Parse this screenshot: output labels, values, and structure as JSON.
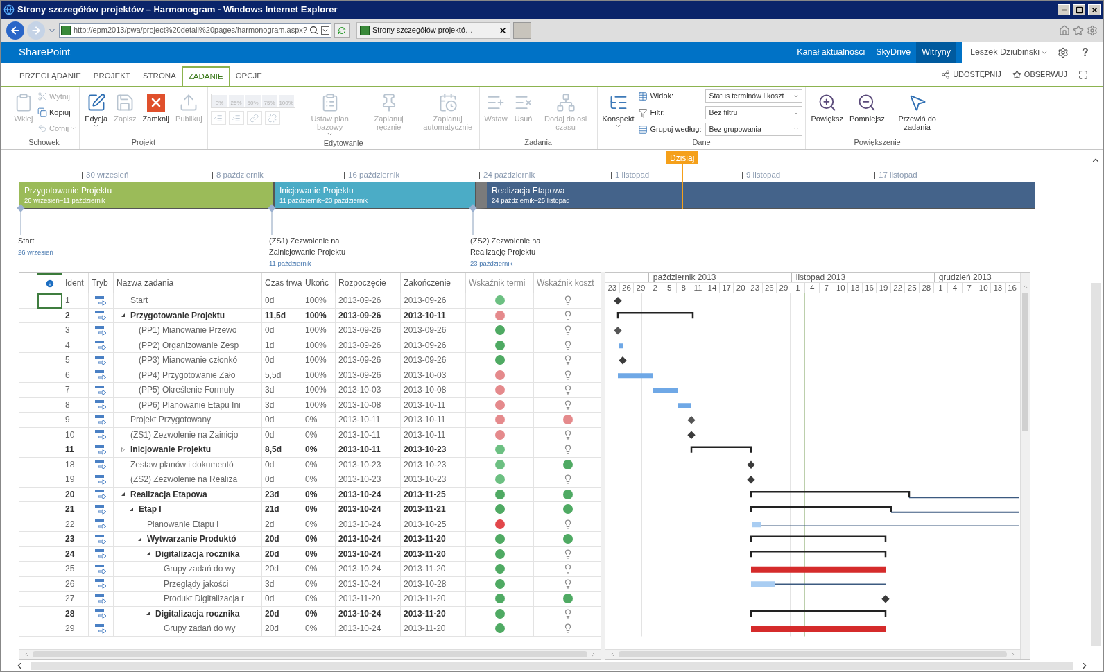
{
  "window": {
    "title": "Strony szczegółów projektów – Harmonogram - Windows Internet Explorer"
  },
  "browser": {
    "address": "http://epm2013/pwa/project%20detail%20pages/harmonogram.aspx?",
    "tab": "Strony szczegółów projektó…"
  },
  "suite_bar": {
    "brand": "SharePoint",
    "links": [
      {
        "label": "Kanał aktualności",
        "selected": false
      },
      {
        "label": "SkyDrive",
        "selected": false
      },
      {
        "label": "Witryny",
        "selected": true
      }
    ],
    "user": "Leszek Dziubiński",
    "help": "?"
  },
  "ribbon": {
    "tabs": [
      {
        "label": "PRZEGLĄDANIE",
        "selected": false
      },
      {
        "label": "PROJEKT",
        "selected": false
      },
      {
        "label": "STRONA",
        "selected": false
      },
      {
        "label": "ZADANIE",
        "selected": true
      },
      {
        "label": "OPCJE",
        "selected": false
      }
    ],
    "actions": [
      "UDOSTĘPNIJ",
      "OBSERWUJ"
    ],
    "groups": [
      {
        "title": "Schowek",
        "items": [
          {
            "kind": "large",
            "label": "Wklej",
            "disabled": true
          },
          {
            "kind": "small",
            "label": "Wytnij",
            "disabled": true
          },
          {
            "kind": "small",
            "label": "Kopiuj",
            "disabled": false
          },
          {
            "kind": "small",
            "label": "Cofnij",
            "disabled": true,
            "menu": true
          }
        ]
      },
      {
        "title": "Projekt",
        "items": [
          {
            "kind": "large",
            "label": "Edycja",
            "disabled": false,
            "menu": true
          },
          {
            "kind": "large",
            "label": "Zapisz",
            "disabled": true
          },
          {
            "kind": "large",
            "label": "Zamknij",
            "disabled": false
          },
          {
            "kind": "large",
            "label": "Publikuj",
            "disabled": true
          }
        ]
      },
      {
        "title": "Edytowanie",
        "items": [
          {
            "kind": "percent",
            "label": "0%",
            "disabled": true
          },
          {
            "kind": "percent",
            "label": "25%",
            "disabled": true
          },
          {
            "kind": "percent",
            "label": "50%",
            "disabled": true
          },
          {
            "kind": "percent",
            "label": "75%",
            "disabled": true
          },
          {
            "kind": "percent",
            "label": "100%",
            "disabled": true
          },
          {
            "kind": "tool",
            "disabled": true
          },
          {
            "kind": "tool",
            "disabled": true
          },
          {
            "kind": "tool",
            "disabled": true
          },
          {
            "kind": "tool",
            "disabled": true
          },
          {
            "kind": "large",
            "label": "Ustaw plan bazowy",
            "disabled": true,
            "menu": true
          },
          {
            "kind": "large",
            "label": "Zaplanuj ręcznie",
            "disabled": true
          },
          {
            "kind": "large",
            "label": "Zaplanuj automatycznie",
            "disabled": true
          }
        ]
      },
      {
        "title": "Zadania",
        "items": [
          {
            "kind": "large",
            "label": "Wstaw",
            "disabled": true
          },
          {
            "kind": "large",
            "label": "Usuń",
            "disabled": true
          },
          {
            "kind": "large",
            "label": "Dodaj do osi czasu",
            "disabled": true
          }
        ]
      },
      {
        "title": "Dane",
        "items": [
          {
            "kind": "large",
            "label": "Konspekt",
            "disabled": false,
            "menu": true
          },
          {
            "kind": "dropdown",
            "label": "Widok:",
            "value": "Status terminów i koszt",
            "disabled": false
          },
          {
            "kind": "dropdown",
            "label": "Filtr:",
            "value": "Bez filtru",
            "disabled": false
          },
          {
            "kind": "dropdown",
            "label": "Grupuj według:",
            "value": "Bez grupowania",
            "disabled": false
          }
        ]
      },
      {
        "title": "Powiększenie",
        "items": [
          {
            "kind": "large",
            "label": "Powiększ",
            "disabled": false
          },
          {
            "kind": "large",
            "label": "Pomniejsz",
            "disabled": false
          },
          {
            "kind": "large",
            "label": "Przewiń do zadania",
            "disabled": false
          }
        ]
      }
    ]
  },
  "timeline": {
    "today": "Dzisiaj",
    "ticks": [
      "30 wrzesień",
      "8 październik",
      "16 październik",
      "24 październik",
      "1 listopad",
      "9 listopad",
      "17 listopad"
    ],
    "phases": [
      {
        "title": "Przygotowanie Projektu",
        "dates": "26 wrzesień–11 październik",
        "color": "#9bbb59"
      },
      {
        "title": "Inicjowanie Projektu",
        "dates": "11 październik–23 październik",
        "color": "#4bacc6"
      },
      {
        "title": "Realizacja Etapowa",
        "dates": "24 październik–25 listopad",
        "color": "#44638a"
      }
    ],
    "milestones": [
      {
        "title": "Start",
        "date": "26 wrzesień"
      },
      {
        "title": "(ZS1) Zezwolenie na Zainicjowanie Projektu",
        "date": "11 październik"
      },
      {
        "title": "(ZS2) Zezwolenie na Realizację Projektu",
        "date": "23 październik"
      }
    ]
  },
  "grid": {
    "columns": [
      "Ident",
      "Tryb",
      "Nazwa zadania",
      "Czas trwa",
      "Ukońc",
      "Rozpoczęcie",
      "Zakończenie",
      "Wskaźnik termi",
      "Wskaźnik koszt"
    ],
    "rows": [
      {
        "id": "1",
        "name": "Start",
        "duration": "0d",
        "complete": "100%",
        "start": "2013-09-26",
        "finish": "2013-09-26",
        "schedule": {
          "color": "#6cc082"
        },
        "cost": {
          "kind": "bulb"
        },
        "selected": true
      },
      {
        "id": "2",
        "name": "Przygotowanie Projektu",
        "duration": "11,5d",
        "complete": "100%",
        "start": "2013-09-26",
        "finish": "2013-10-11",
        "schedule": {
          "color": "#e58a8c"
        },
        "cost": {
          "kind": "bulb"
        },
        "selected": false,
        "summary": true,
        "expanded": true,
        "children": [
          {
            "id": "3",
            "name": "(PP1) Mianowanie Przewo",
            "duration": "0d",
            "complete": "100%",
            "start": "2013-09-26",
            "finish": "2013-09-26",
            "schedule": {
              "color": "#4faa63"
            },
            "cost": {
              "kind": "bulb"
            },
            "selected": false
          },
          {
            "id": "4",
            "name": "(PP2) Organizowanie Zesp",
            "duration": "1d",
            "complete": "100%",
            "start": "2013-09-26",
            "finish": "2013-09-26",
            "schedule": {
              "color": "#4faa63"
            },
            "cost": {
              "kind": "bulb"
            },
            "selected": false
          },
          {
            "id": "5",
            "name": "(PP3) Mianowanie członkó",
            "duration": "0d",
            "complete": "100%",
            "start": "2013-09-26",
            "finish": "2013-09-26",
            "schedule": {
              "color": "#4faa63"
            },
            "cost": {
              "kind": "bulb"
            },
            "selected": false
          },
          {
            "id": "6",
            "name": "(PP4) Przygotowanie Zało",
            "duration": "5,5d",
            "complete": "100%",
            "start": "2013-09-26",
            "finish": "2013-10-03",
            "schedule": {
              "color": "#e58a8c"
            },
            "cost": {
              "kind": "bulb"
            },
            "selected": false
          },
          {
            "id": "7",
            "name": "(PP5) Określenie Formuły",
            "duration": "3d",
            "complete": "100%",
            "start": "2013-10-03",
            "finish": "2013-10-08",
            "schedule": {
              "color": "#e58a8c"
            },
            "cost": {
              "kind": "bulb"
            },
            "selected": false
          },
          {
            "id": "8",
            "name": "(PP6) Planowanie Etapu Ini",
            "duration": "3d",
            "complete": "100%",
            "start": "2013-10-08",
            "finish": "2013-10-11",
            "schedule": {
              "color": "#e58a8c"
            },
            "cost": {
              "kind": "bulb"
            },
            "selected": false
          }
        ]
      },
      {
        "id": "9",
        "name": "Projekt Przygotowany",
        "duration": "0d",
        "complete": "0%",
        "start": "2013-10-11",
        "finish": "2013-10-11",
        "schedule": {
          "color": "#e58a8c"
        },
        "cost": {
          "kind": "dot",
          "color": "#e58a8c"
        },
        "selected": false
      },
      {
        "id": "10",
        "name": "(ZS1) Zezwolenie na Zainicjo",
        "duration": "0d",
        "complete": "0%",
        "start": "2013-10-11",
        "finish": "2013-10-11",
        "schedule": {
          "color": "#e58a8c"
        },
        "cost": {
          "kind": "bulb"
        },
        "selected": false
      },
      {
        "id": "11",
        "name": "Inicjowanie Projektu",
        "duration": "8,5d",
        "complete": "0%",
        "start": "2013-10-11",
        "finish": "2013-10-23",
        "schedule": {
          "color": "#6cc082"
        },
        "cost": {
          "kind": "bulb"
        },
        "selected": false,
        "summary": true,
        "expanded": false
      },
      {
        "id": "18",
        "name": "Zestaw planów i dokumentó",
        "duration": "0d",
        "complete": "0%",
        "start": "2013-10-23",
        "finish": "2013-10-23",
        "schedule": {
          "color": "#6cc082"
        },
        "cost": {
          "kind": "dot",
          "color": "#4faa63"
        },
        "selected": false
      },
      {
        "id": "19",
        "name": "(ZS2) Zezwolenie na Realiza",
        "duration": "0d",
        "complete": "0%",
        "start": "2013-10-23",
        "finish": "2013-10-23",
        "schedule": {
          "color": "#6cc082"
        },
        "cost": {
          "kind": "bulb"
        },
        "selected": false
      },
      {
        "id": "20",
        "name": "Realizacja Etapowa",
        "duration": "23d",
        "complete": "0%",
        "start": "2013-10-24",
        "finish": "2013-11-25",
        "schedule": {
          "color": "#4faa63"
        },
        "cost": {
          "kind": "dot",
          "color": "#4faa63"
        },
        "selected": false,
        "summary": true,
        "expanded": true,
        "children": [
          {
            "id": "21",
            "name": "Etap I",
            "duration": "21d",
            "complete": "0%",
            "start": "2013-10-24",
            "finish": "2013-11-21",
            "schedule": {
              "color": "#4faa63"
            },
            "cost": {
              "kind": "dot",
              "color": "#4faa63"
            },
            "selected": false,
            "summary": true,
            "expanded": true,
            "children": [
              {
                "id": "22",
                "name": "Planowanie Etapu I",
                "duration": "2d",
                "complete": "0%",
                "start": "2013-10-24",
                "finish": "2013-10-25",
                "schedule": {
                  "color": "#e2474b"
                },
                "cost": {
                  "kind": "bulb"
                },
                "selected": false
              },
              {
                "id": "23",
                "name": "Wytwarzanie Produktó",
                "duration": "20d",
                "complete": "0%",
                "start": "2013-10-24",
                "finish": "2013-11-20",
                "schedule": {
                  "color": "#4faa63"
                },
                "cost": {
                  "kind": "dot",
                  "color": "#4faa63"
                },
                "selected": false,
                "summary": true,
                "expanded": true,
                "children": [
                  {
                    "id": "24",
                    "name": "Digitalizacja rocznika",
                    "duration": "20d",
                    "complete": "0%",
                    "start": "2013-10-24",
                    "finish": "2013-11-20",
                    "schedule": {
                      "color": "#4faa63"
                    },
                    "cost": {
                      "kind": "bulb"
                    },
                    "selected": false,
                    "summary": true,
                    "expanded": true,
                    "children": [
                      {
                        "id": "25",
                        "name": "Grupy zadań do wy",
                        "duration": "20d",
                        "complete": "0%",
                        "start": "2013-10-24",
                        "finish": "2013-11-20",
                        "schedule": {
                          "color": "#4faa63"
                        },
                        "cost": {
                          "kind": "bulb"
                        },
                        "selected": false
                      },
                      {
                        "id": "26",
                        "name": "Przeglądy jakości",
                        "duration": "3d",
                        "complete": "0%",
                        "start": "2013-10-24",
                        "finish": "2013-10-28",
                        "schedule": {
                          "color": "#4faa63"
                        },
                        "cost": {
                          "kind": "bulb"
                        },
                        "selected": false
                      },
                      {
                        "id": "27",
                        "name": "Produkt Digitalizacja r",
                        "duration": "0d",
                        "complete": "0%",
                        "start": "2013-11-20",
                        "finish": "2013-11-20",
                        "schedule": {
                          "color": "#4faa63"
                        },
                        "cost": {
                          "kind": "dot",
                          "color": "#4faa63"
                        },
                        "selected": false
                      }
                    ]
                  },
                  {
                    "id": "28",
                    "name": "Digitalizacja rocznika",
                    "duration": "20d",
                    "complete": "0%",
                    "start": "2013-10-24",
                    "finish": "2013-11-20",
                    "schedule": {
                      "color": "#4faa63"
                    },
                    "cost": {
                      "kind": "bulb"
                    },
                    "selected": false,
                    "summary": true,
                    "expanded": true,
                    "children": [
                      {
                        "id": "29",
                        "name": "Grupy zadań do wy",
                        "duration": "20d",
                        "complete": "0%",
                        "start": "2013-10-24",
                        "finish": "2013-11-20",
                        "schedule": {
                          "color": "#4faa63"
                        },
                        "cost": {
                          "kind": "bulb"
                        },
                        "selected": false
                      }
                    ]
                  }
                ]
              }
            ]
          }
        ]
      }
    ]
  },
  "gantt": {
    "months": [
      "październik 2013",
      "listopad 2013",
      "grudzień 2013"
    ],
    "days": [
      "23",
      "26",
      "29",
      "2",
      "5",
      "8",
      "11",
      "14",
      "17",
      "20",
      "23",
      "26",
      "29",
      "1",
      "4",
      "7",
      "10",
      "13",
      "16",
      "19",
      "22",
      "25",
      "28",
      "1",
      "4",
      "7",
      "10",
      "13",
      "16"
    ]
  }
}
